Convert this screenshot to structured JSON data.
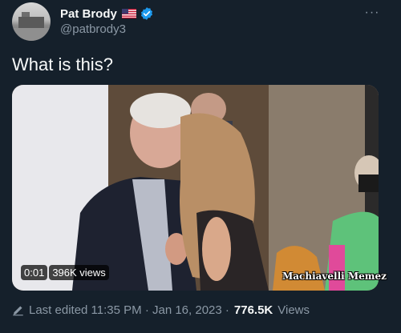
{
  "author": {
    "display_name": "Pat Brody",
    "handle": "@patbrody3",
    "flag_icon": "us-flag-icon",
    "verified_icon": "verified-badge-icon"
  },
  "more_menu": {
    "label": "···"
  },
  "tweet": {
    "text": "What is this?"
  },
  "video": {
    "duration": "0:01",
    "views": "396K views",
    "watermark": "Machiavelli Memez"
  },
  "footer": {
    "edited_label": "Last edited 11:35 PM · Jan 16, 2023 ·",
    "views_count": "776.5K",
    "views_label": "Views"
  },
  "colors": {
    "background": "#15202b",
    "text_primary": "#f7f9f9",
    "text_secondary": "#8b98a5",
    "verified": "#1d9bf0"
  }
}
